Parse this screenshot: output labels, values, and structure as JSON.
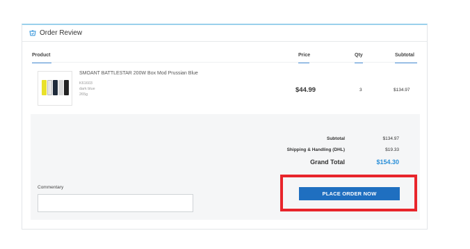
{
  "panel": {
    "title": "Order Review"
  },
  "columns": {
    "product": "Product",
    "price": "Price",
    "qty": "Qty",
    "subtotal": "Subtotal"
  },
  "item": {
    "name": "SMOANT BATTLESTAR 200W Box Mod Prussian Blue",
    "sku": "K61603",
    "color": "dark blue",
    "weight": "265g",
    "price": "$44.99",
    "qty": "3",
    "subtotal": "$134.97",
    "thumbnail_icon": "product-thumbnail"
  },
  "summary": {
    "subtotal_label": "Subtotal",
    "subtotal_value": "$134.97",
    "shipping_label": "Shipping & Handling (DHL)",
    "shipping_value": "$19.33",
    "grand_label": "Grand Total",
    "grand_value": "$154.30"
  },
  "commentary": {
    "label": "Commentary",
    "value": ""
  },
  "place_order": {
    "label": "PLACE ORDER NOW"
  },
  "colors": {
    "accent": "#1f6fc0",
    "grand_total": "#2a8fd8",
    "highlight": "#e8252b"
  }
}
